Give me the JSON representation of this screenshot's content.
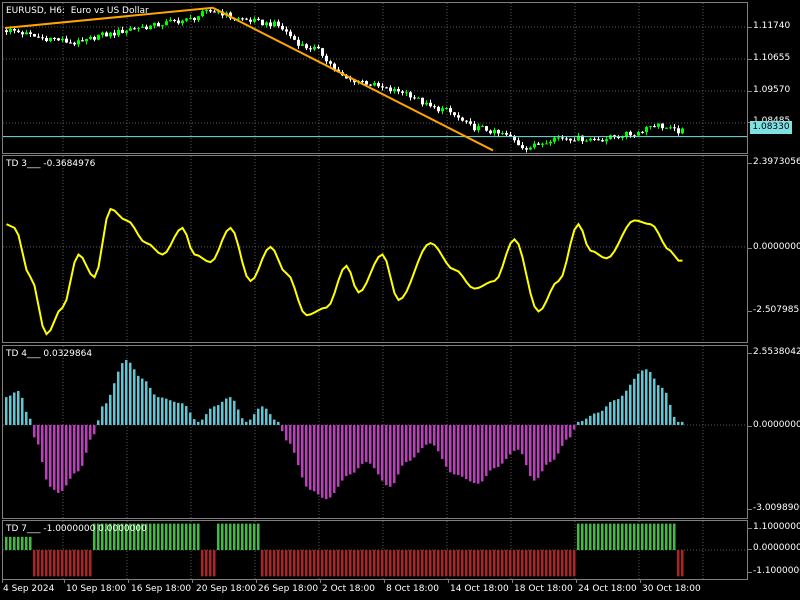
{
  "panes": [
    {
      "id": "price",
      "label": "EURUSD, H6:  Euro vs US Dollar"
    },
    {
      "id": "td3",
      "label": "TD 3___ -0.3684976"
    },
    {
      "id": "td4",
      "label": "TD 4___ 0.0329864"
    },
    {
      "id": "td7",
      "label": "TD 7___ -1.0000000 0.0000000"
    }
  ],
  "price_axis": {
    "ticks": [
      "1.11740",
      "1.10655",
      "1.09570",
      "1.08485"
    ],
    "current": "1.08330",
    "range": [
      1.0782,
      1.125
    ]
  },
  "td3_axis": {
    "ticks": [
      "2.3973056",
      "0.0000000",
      "-2.5079857"
    ],
    "range": [
      -2.5079857,
      2.3973056
    ]
  },
  "td4_axis": {
    "ticks": [
      "2.5538042",
      "0.0000000",
      "-3.0098900"
    ],
    "range": [
      -3.00989,
      2.5538042
    ]
  },
  "td7_axis": {
    "ticks": [
      "1.1000000",
      "0.0000000",
      "-1.1000000"
    ],
    "range": [
      -1.1,
      1.1
    ]
  },
  "time_axis": {
    "labels": [
      "4 Sep 2024",
      "10 Sep 18:00",
      "16 Sep 18:00",
      "20 Sep 18:00",
      "26 Sep 18:00",
      "2 Oct 18:00",
      "8 Oct 18:00",
      "14 Oct 18:00",
      "18 Oct 18:00",
      "24 Oct 18:00",
      "30 Oct 18:00"
    ]
  },
  "colors": {
    "bull": "#00ff00",
    "bear": "#ffffff",
    "trend": "#ffa500",
    "priceline": "#7fe1e1",
    "td3": "#ffff00",
    "td4_pos": "#5bc8d6",
    "td4_neg": "#c03cc0",
    "td7_pos": "#3cbf3c",
    "td7_neg": "#b22222"
  },
  "trendlines": [
    {
      "from": [
        0,
        1.1172
      ],
      "to": [
        52,
        1.1235
      ]
    },
    {
      "from": [
        52,
        1.1235
      ],
      "to": [
        122,
        1.079
      ]
    }
  ]
}
